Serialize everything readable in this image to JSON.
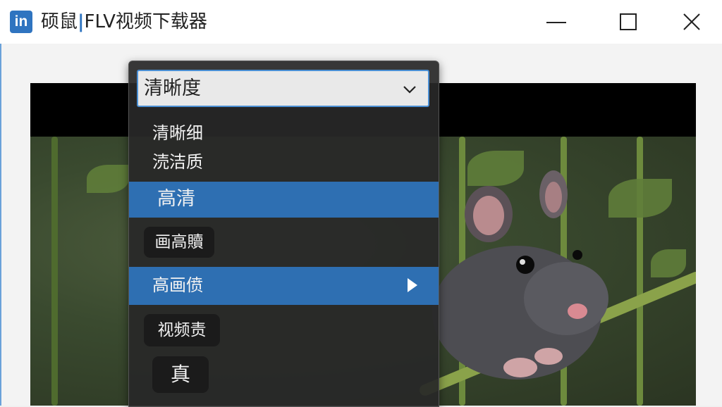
{
  "app": {
    "icon_text": "in",
    "title_prefix": "硕鼠",
    "title_cursor": "|",
    "title_suffix": "FLV视频下载器"
  },
  "window_controls": {
    "minimize": "minimize-icon",
    "maximize": "maximize-icon",
    "close": "close-icon"
  },
  "dropdown": {
    "selected": "清晰度",
    "options": [
      {
        "label": "清晰细",
        "style": "plain"
      },
      {
        "label": "涜洁质",
        "style": "plain"
      },
      {
        "label": "高清",
        "style": "highlighted"
      },
      {
        "label": "画高贖",
        "style": "chip"
      },
      {
        "label": "高画偾",
        "style": "highlighted-submenu"
      },
      {
        "label": "视频责",
        "style": "chip"
      },
      {
        "label": "真",
        "style": "chip"
      }
    ]
  },
  "colors": {
    "accent": "#2e6fb2",
    "focus_border": "#4a8fd4",
    "app_icon": "#2f74c0"
  }
}
